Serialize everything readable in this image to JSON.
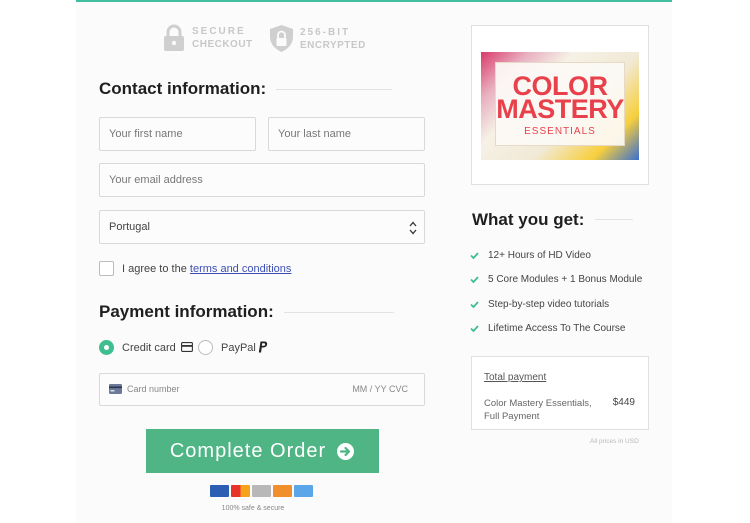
{
  "badges": {
    "secure": {
      "line1": "SECURE",
      "line2": "CHECKOUT",
      "icon": "lock-icon"
    },
    "encrypted": {
      "line1": "256-BIT",
      "line2": "ENCRYPTED",
      "icon": "shield-lock-icon"
    }
  },
  "contact": {
    "heading": "Contact information:",
    "first_name_placeholder": "Your first name",
    "last_name_placeholder": "Your last name",
    "email_placeholder": "Your email address",
    "country_value": "Portugal",
    "agree_prefix": "I agree to the",
    "terms_link": "terms and conditions"
  },
  "payment": {
    "heading": "Payment information:",
    "credit_card_label": "Credit card",
    "paypal_label": "PayPal",
    "selected_method": "Credit card",
    "card_number_placeholder": "Card number",
    "expiry_cvc_placeholder": "MM / YY  CVC",
    "complete_order_label": "Complete Order",
    "safe_text": "100% safe & secure",
    "card_brands": [
      "visa",
      "mastercard",
      "amex",
      "discover",
      "unionpay"
    ]
  },
  "product": {
    "title_line1": "COLOR",
    "title_line2": "MASTERY",
    "title_line3": "ESSENTIALS"
  },
  "features": {
    "heading": "What you get:",
    "items": [
      "12+ Hours of HD Video",
      "5 Core Modules + 1 Bonus Module",
      "Step-by-step video tutorials",
      "Lifetime Access To The Course"
    ]
  },
  "summary": {
    "title": "Total payment",
    "item_line1": "Color Mastery Essentials,",
    "item_line2": "Full Payment",
    "price": "$449",
    "currency_note": "All prices in USD"
  },
  "colors": {
    "accent": "#4fb585",
    "top_bar": "#3fbf9f",
    "link": "#3d4fb5",
    "badge_gray": "#c8c8c8"
  }
}
